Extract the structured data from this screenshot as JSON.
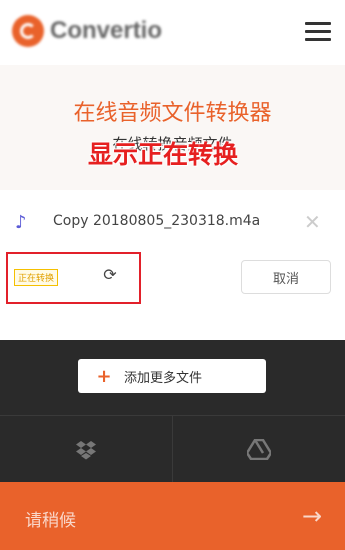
{
  "app": {
    "logo_text": "Convertio"
  },
  "hero": {
    "title": "在线音频文件转换器",
    "subtitle": "在线转换音频文件",
    "overlay": "显示正在转换"
  },
  "file": {
    "icon": "music-note-icon",
    "name": "Copy 20180805_230318.m4a",
    "status": "正在转换",
    "cancel_label": "取消"
  },
  "actions": {
    "add_more_label": "添加更多文件",
    "cloud_icons": [
      "dropbox-icon",
      "google-drive-icon"
    ]
  },
  "footer": {
    "wait_label": "请稍候"
  },
  "colors": {
    "accent": "#e9622b",
    "highlight": "#e2202a",
    "dark": "#2a2a2a"
  }
}
